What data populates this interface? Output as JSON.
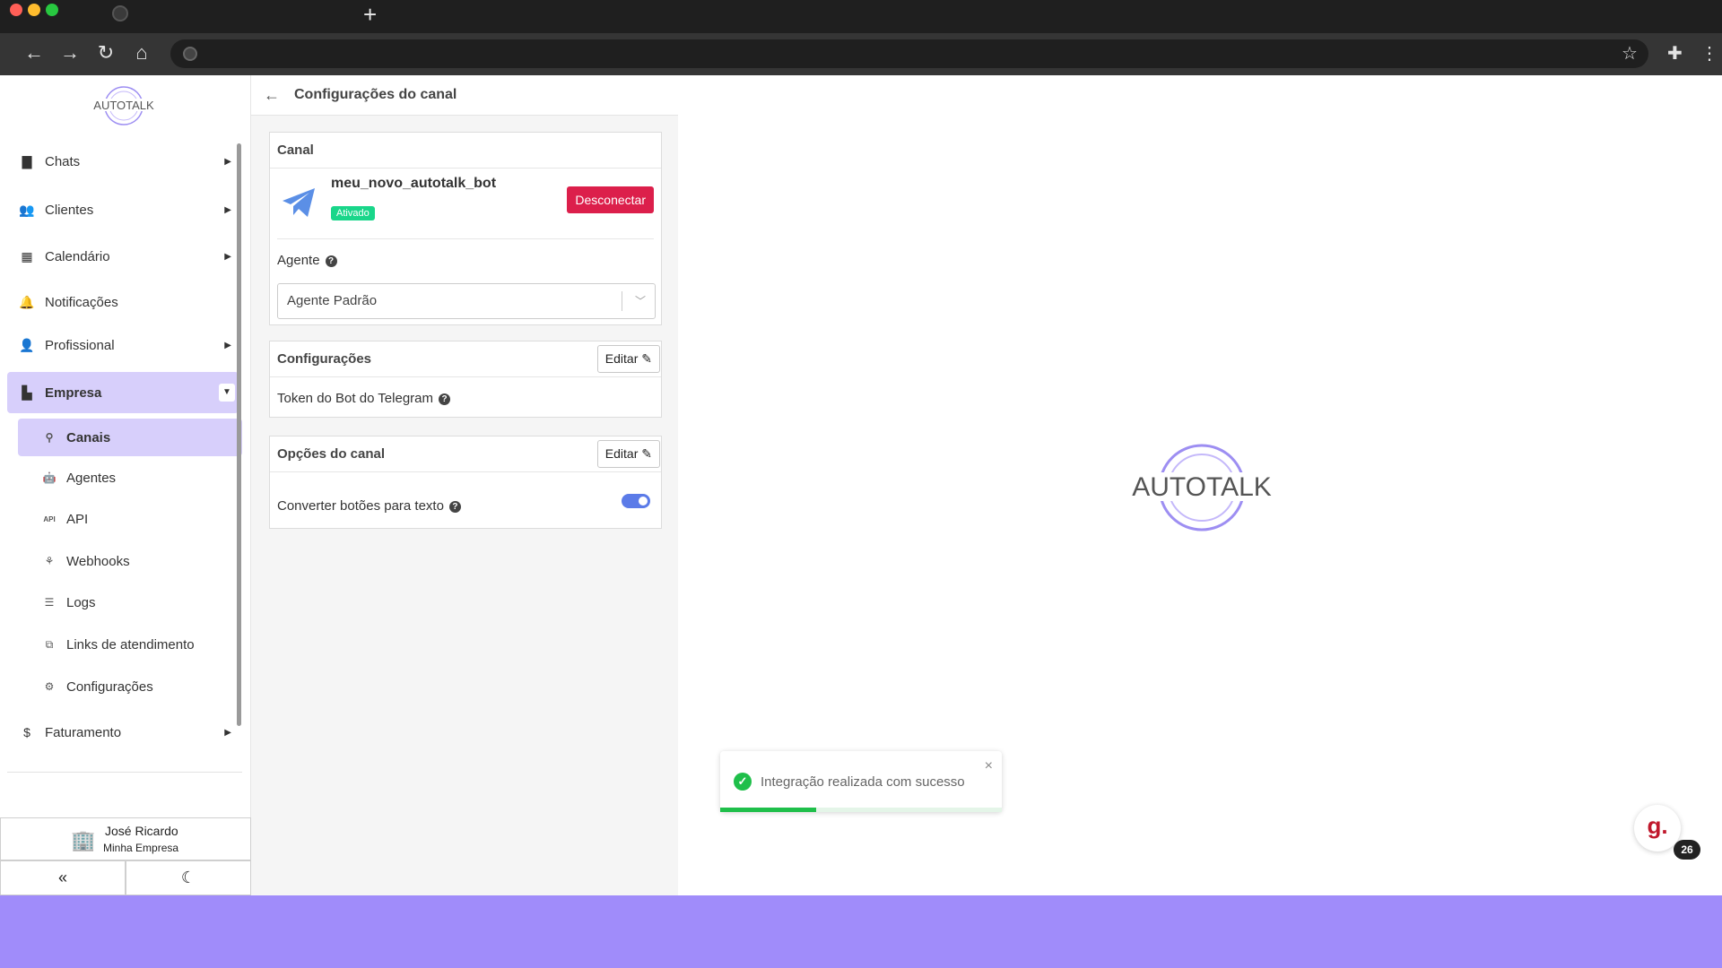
{
  "browser": {
    "new_tab": "+",
    "back": "←",
    "forward": "→",
    "reload": "↻",
    "home": "⌂",
    "star": "☆",
    "ext": "✚",
    "menu": "⋮"
  },
  "brand": {
    "logo_text": "AUTOTALK"
  },
  "sidebar": {
    "items": [
      {
        "label": "Chats",
        "icon": "chat-icon"
      },
      {
        "label": "Clientes",
        "icon": "users-icon"
      },
      {
        "label": "Calendário",
        "icon": "calendar-icon"
      },
      {
        "label": "Notificações",
        "icon": "bell-icon"
      },
      {
        "label": "Profissional",
        "icon": "user-cog-icon"
      },
      {
        "label": "Empresa",
        "icon": "building-icon"
      },
      {
        "label": "Faturamento",
        "icon": "dollar-icon"
      }
    ],
    "sub_items": [
      {
        "label": "Canais",
        "icon": "plug-icon"
      },
      {
        "label": "Agentes",
        "icon": "robot-icon"
      },
      {
        "label": "API",
        "icon": "api-icon"
      },
      {
        "label": "Webhooks",
        "icon": "webhook-icon"
      },
      {
        "label": "Logs",
        "icon": "list-icon"
      },
      {
        "label": "Links de atendimento",
        "icon": "external-link-icon"
      },
      {
        "label": "Configurações",
        "icon": "gear-icon"
      }
    ],
    "user": {
      "name": "José Ricardo",
      "company": "Minha Empresa"
    },
    "collapse": "«",
    "theme": "☾"
  },
  "panel": {
    "title": "Configurações do canal",
    "canal_card": {
      "header": "Canal",
      "bot_name": "meu_novo_autotalk_bot",
      "status": "Ativado",
      "disconnect_label": "Desconectar",
      "agent_label": "Agente",
      "agent_value": "Agente Padrão"
    },
    "config_card": {
      "header": "Configurações",
      "edit_label": "Editar",
      "token_label": "Token do Bot do Telegram"
    },
    "options_card": {
      "header": "Opções do canal",
      "edit_label": "Editar",
      "convert_label": "Converter botões para texto",
      "convert_enabled": true
    }
  },
  "toast": {
    "message": "Integração realizada com sucesso",
    "close": "×",
    "progress": 0.34
  },
  "widget": {
    "letter": "g.",
    "count": "26"
  },
  "colors": {
    "accent": "#d7cffb",
    "danger": "#dc1f4b",
    "success": "#1fbf4a",
    "badge": "#19d68a",
    "toggle": "#5b7be8",
    "background": "#a08cfa"
  }
}
